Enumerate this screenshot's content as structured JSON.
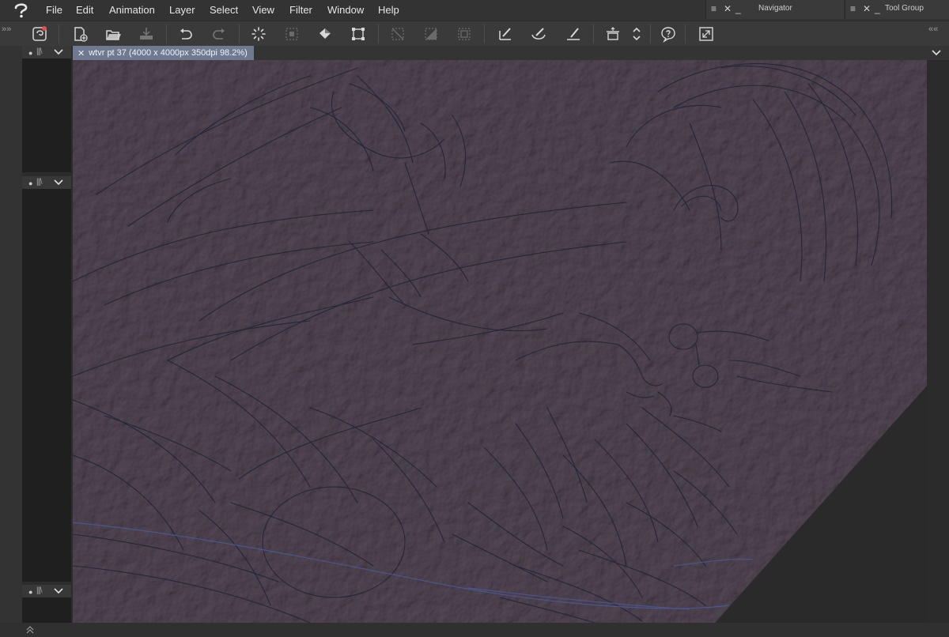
{
  "menubar": {
    "items": [
      "File",
      "Edit",
      "Animation",
      "Layer",
      "Select",
      "View",
      "Filter",
      "Window",
      "Help"
    ]
  },
  "panels": {
    "navigator": {
      "title": "Navigator"
    },
    "tool_group": {
      "title": "Tool Group"
    }
  },
  "toolbar": {
    "icons": [
      "clip-studio-icon",
      "new-file-icon",
      "open-file-icon",
      "save-icon",
      "undo-icon",
      "redo-icon",
      "clear-icon",
      "clear-outside-selection-icon",
      "fill-icon",
      "transform-icon",
      "deselect-icon",
      "invert-selection-icon",
      "show-selection-area-icon",
      "snap-to-ruler-icon",
      "snap-to-special-ruler-icon",
      "snap-to-grid-icon",
      "canvas-settings-icon",
      "up-down-arrows-icon",
      "help-icon",
      "fullscreen-icon"
    ]
  },
  "document": {
    "tab_label": "wtvr pt 37 (4000 x 4000px 350dpi 98.2%)",
    "close_glyph": "✕"
  },
  "dock": {
    "header_dot": "●",
    "header_bars": "|||\\"
  },
  "colors": {
    "paper": "#857a84",
    "ink": "#1d2236",
    "blue_line": "#4a5a9a",
    "tab_active": "#6f7990"
  }
}
